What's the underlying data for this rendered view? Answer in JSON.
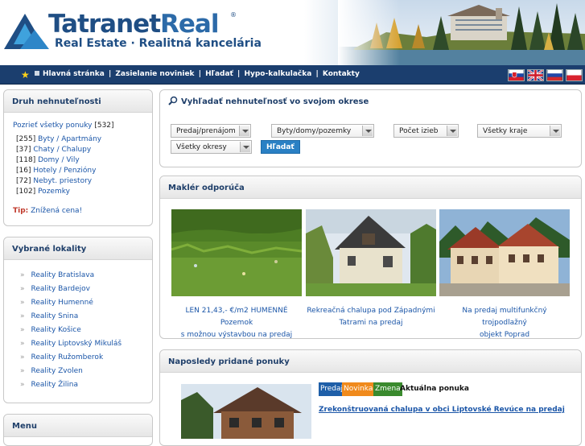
{
  "brand": {
    "name_part1": "Tatranet",
    "name_part2": "Real",
    "registered": "®",
    "tagline": "Real Estate · Realitná kancelária"
  },
  "nav": {
    "items": [
      "Hlavná stránka",
      "Zasielanie noviniek",
      "Hľadať",
      "Hypo-kalkulačka",
      "Kontakty"
    ],
    "separator": "|"
  },
  "flags": [
    "sk",
    "gb",
    "ru",
    "pl"
  ],
  "property_types": {
    "heading": "Druh nehnuteľnosti",
    "show_all": "Pozrieť všetky ponuky",
    "show_all_count": "[532]",
    "items": [
      {
        "count": "[255]",
        "label": "Byty / Apartmány"
      },
      {
        "count": "[37]",
        "label": "Chaty / Chalupy"
      },
      {
        "count": "[118]",
        "label": "Domy / Vily"
      },
      {
        "count": "[16]",
        "label": "Hotely / Penzióny"
      },
      {
        "count": "[72]",
        "label": "Nebyt. priestory"
      },
      {
        "count": "[102]",
        "label": "Pozemky"
      }
    ],
    "tip_label": "Tip:",
    "tip_link": "Znížená cena!"
  },
  "localities": {
    "heading": "Vybrané lokality",
    "bullet": "»",
    "items": [
      "Reality Bratislava",
      "Reality Bardejov",
      "Reality Humenné",
      "Reality Snina",
      "Reality Košice",
      "Reality Liptovský Mikuláš",
      "Reality Ružomberok",
      "Reality Zvolen",
      "Reality Žilina"
    ]
  },
  "menu": {
    "heading": "Menu"
  },
  "search": {
    "heading": "Vyhľadať nehnuteľnosť vo svojom okrese",
    "select_offer": "Predaj/prenájom",
    "select_type": "Byty/domy/pozemky",
    "select_rooms": "Počet izieb",
    "select_region": "Všetky kraje",
    "select_district": "Všetky okresy",
    "button": "Hľadať"
  },
  "recommended": {
    "heading": "Maklér odporúča",
    "items": [
      {
        "caption_line1": "LEN 21,43,- €/m2 HUMENNÉ Pozemok",
        "caption_line2": "s možnou výstavbou na predaj"
      },
      {
        "caption_line1": "Rekreačná chalupa pod Západnými",
        "caption_line2": "Tatrami na predaj"
      },
      {
        "caption_line1": "Na predaj multifunkčný trojpodlažný",
        "caption_line2": "objekt Poprad"
      }
    ]
  },
  "recent": {
    "heading": "Naposledy pridané ponuky",
    "tags": [
      {
        "label": "Predaj",
        "color": "#1f5fa8"
      },
      {
        "label": "Novinka",
        "color": "#f08a1c"
      },
      {
        "label": "Zmena",
        "color": "#3a8a2e"
      }
    ],
    "tag_text": "Aktuálna ponuka",
    "title": "Zrekonštruovaná chalupa v obci Liptovské Revúce na predaj"
  },
  "colors": {
    "nav_bg": "#1b3e6e",
    "brand_blue": "#1f4e84",
    "link": "#1b56a8",
    "search_button": "#2a80c4"
  }
}
